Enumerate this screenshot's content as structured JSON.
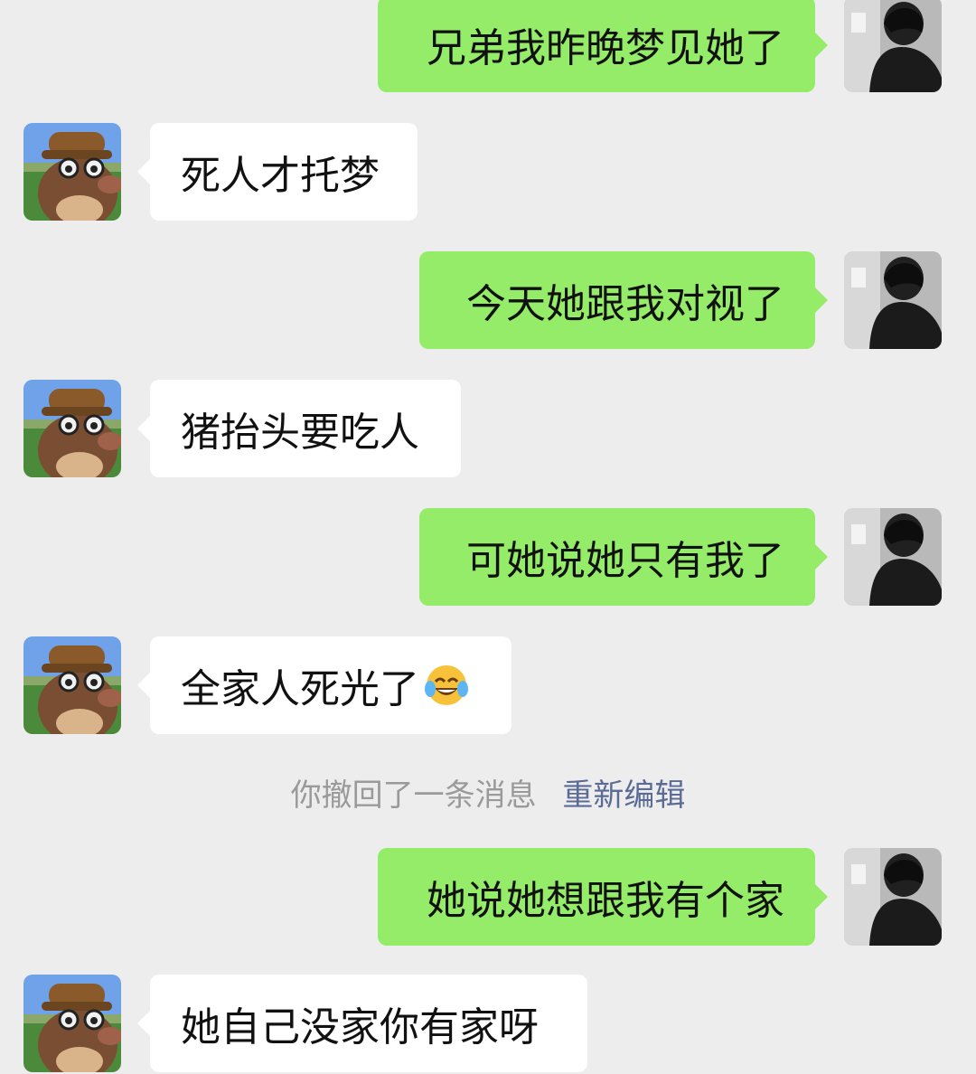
{
  "messages": [
    {
      "side": "right",
      "text": "兄弟我昨晚梦见她了"
    },
    {
      "side": "left",
      "text": "死人才托梦"
    },
    {
      "side": "right",
      "text": "今天她跟我对视了"
    },
    {
      "side": "left",
      "text": "猪抬头要吃人"
    },
    {
      "side": "right",
      "text": "可她说她只有我了"
    },
    {
      "side": "left",
      "text": "全家人死光了",
      "emoji": "tears-of-joy-emoji"
    },
    {
      "side": "right",
      "text": "她说她想跟我有个家"
    },
    {
      "side": "left",
      "text": "她自己没家你有家呀"
    }
  ],
  "system_notice": {
    "text": "你撤回了一条消息",
    "action_label": "重新编辑"
  },
  "colors": {
    "background": "#ededed",
    "incoming_bubble": "#ffffff",
    "outgoing_bubble": "#95ec69",
    "notice_text": "#9a9a9a",
    "link": "#5b6b95"
  },
  "icons": {
    "incoming_avatar": "cartoon-bear-avatar",
    "outgoing_avatar": "person-photo-avatar"
  }
}
